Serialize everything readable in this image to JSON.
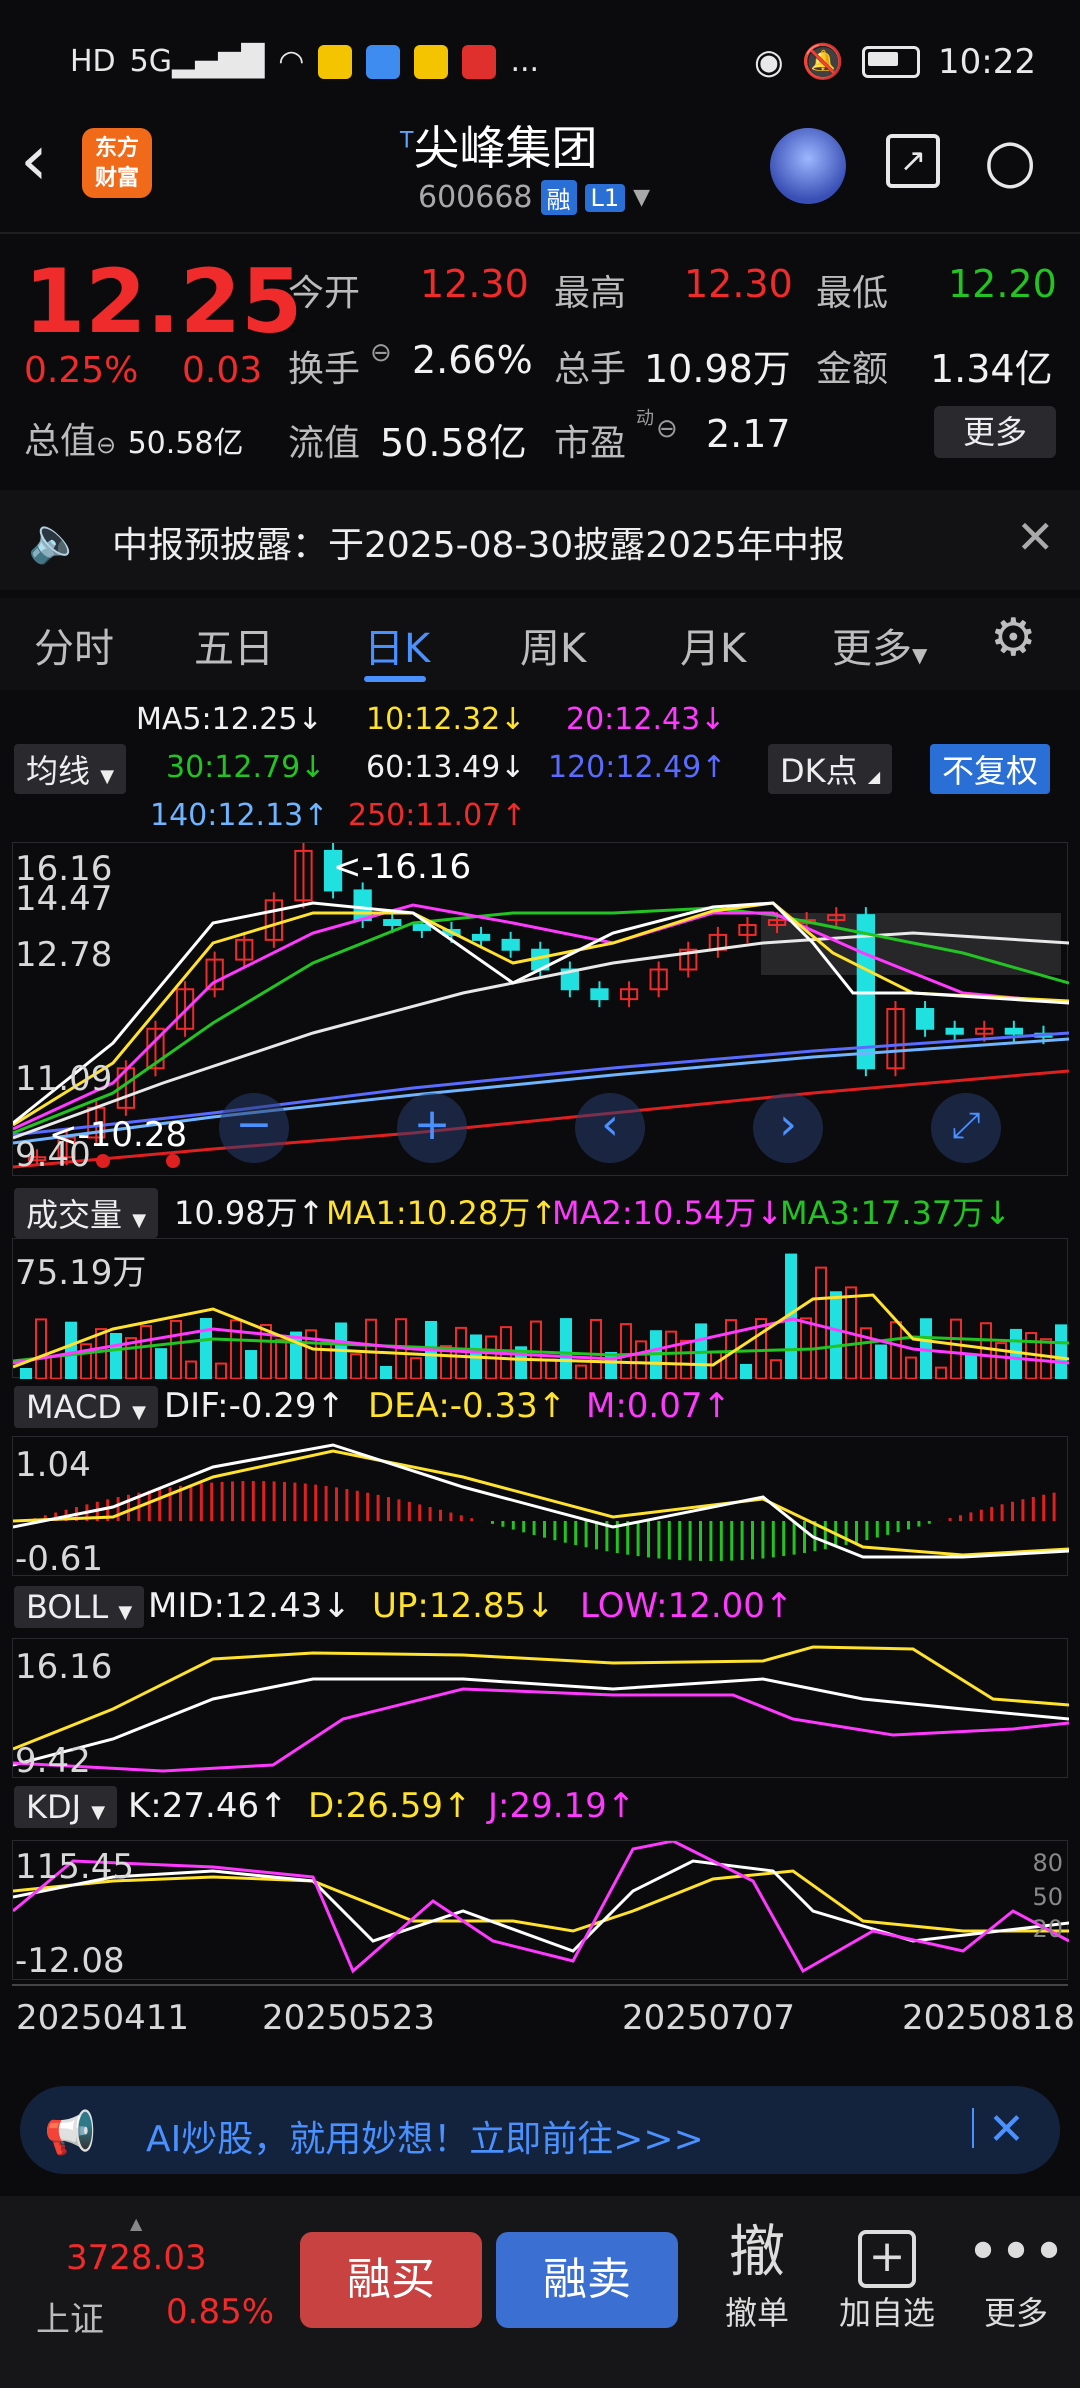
{
  "status": {
    "left_icons": [
      "HD",
      "5G",
      "signal",
      "wifi",
      "app-chip-yellow",
      "app-chip-blue",
      "app-chip-car",
      "app-chip-weibo",
      "..."
    ],
    "time": "10:22"
  },
  "header": {
    "title": "尖峰集团",
    "title_prefix": "T",
    "code": "600668",
    "tag1": "融",
    "tag2": "L1",
    "logo_text_1": "东方",
    "logo_text_2": "财富"
  },
  "quote": {
    "price": "12.25",
    "change_pct": "0.25%",
    "change_amt": "0.03",
    "open_label": "今开",
    "open_val": "12.30",
    "high_label": "最高",
    "high_val": "12.30",
    "low_label": "最低",
    "low_val": "12.20",
    "turnover_label": "换手",
    "turnover_val": "2.66%",
    "volume_label": "总手",
    "volume_val": "10.98万",
    "amount_label": "金额",
    "amount_val": "1.34亿",
    "mktcap_label": "总值",
    "mktcap_val": "50.58亿",
    "float_label": "流值",
    "float_val": "50.58亿",
    "pe_label": "市盈",
    "pe_sup": "动",
    "pe_val": "2.17",
    "more_label": "更多"
  },
  "notice": {
    "text": "中报预披露：于2025-08-30披露2025年中报"
  },
  "tabs": [
    "分时",
    "五日",
    "日K",
    "周K",
    "月K",
    "更多"
  ],
  "active_tab": "日K",
  "ma_legend": {
    "chip": "均线",
    "ma5": "MA5:12.25↓",
    "ma10": "10:12.32↓",
    "ma20": "20:12.43↓",
    "ma30": "30:12.79↓",
    "ma60": "60:13.49↓",
    "ma120": "120:12.49↑",
    "ma140": "140:12.13↑",
    "ma250": "250:11.07↑",
    "dk": "DK点",
    "fq": "不复权"
  },
  "kline_axis": {
    "y1": "16.16",
    "y2": "14.47",
    "y3": "12.78",
    "y4": "11.09",
    "y5": "9.40",
    "max_mark": "<-16.16",
    "min_mark": "<-10.28"
  },
  "volume_legend": {
    "chip": "成交量",
    "vol": "10.98万↑",
    "ma1": "MA1:10.28万↑",
    "ma2": "MA2:10.54万↓",
    "ma3": "MA3:17.37万↓",
    "axis_top": "75.19万"
  },
  "macd_legend": {
    "chip": "MACD",
    "dif": "DIF:-0.29↑",
    "dea": "DEA:-0.33↑",
    "m": "M:0.07↑",
    "axis_top": "1.04",
    "axis_bottom": "-0.61"
  },
  "boll_legend": {
    "chip": "BOLL",
    "mid": "MID:12.43↓",
    "up": "UP:12.85↓",
    "low": "LOW:12.00↑",
    "axis_top": "16.16",
    "axis_bottom": "9.42"
  },
  "kdj_legend": {
    "chip": "KDJ",
    "k": "K:27.46↑",
    "d": "D:26.59↑",
    "j": "J:29.19↑",
    "axis_top": "115.45",
    "axis_bottom": "-12.08",
    "r80": "80",
    "r50": "50",
    "r20": "20"
  },
  "dates": [
    "20250411",
    "20250523",
    "20250707",
    "20250818"
  ],
  "ai_banner": {
    "text": "AI炒股，就用妙想！立即前往>>>"
  },
  "bottom": {
    "index_val": "3728.03",
    "index_name": "上证",
    "index_pct": "0.85%",
    "buy": "融买",
    "sell": "融卖",
    "cancel_icon": "撤",
    "cancel": "撤单",
    "add": "加自选",
    "more": "更多"
  },
  "chart_data": {
    "type": "candlestick",
    "y_range": [
      9.4,
      16.16
    ],
    "close_approx": [
      9.8,
      10.2,
      10.8,
      11.6,
      12.4,
      13.2,
      13.8,
      14.2,
      15.0,
      16.0,
      15.2,
      14.6,
      14.5,
      14.4,
      14.3,
      14.2,
      14.0,
      13.6,
      13.2,
      13.0,
      13.2,
      13.6,
      14.0,
      14.3,
      14.5,
      14.6,
      14.6,
      14.7,
      11.6,
      12.8,
      12.4,
      12.3,
      12.4,
      12.3,
      12.25
    ]
  }
}
